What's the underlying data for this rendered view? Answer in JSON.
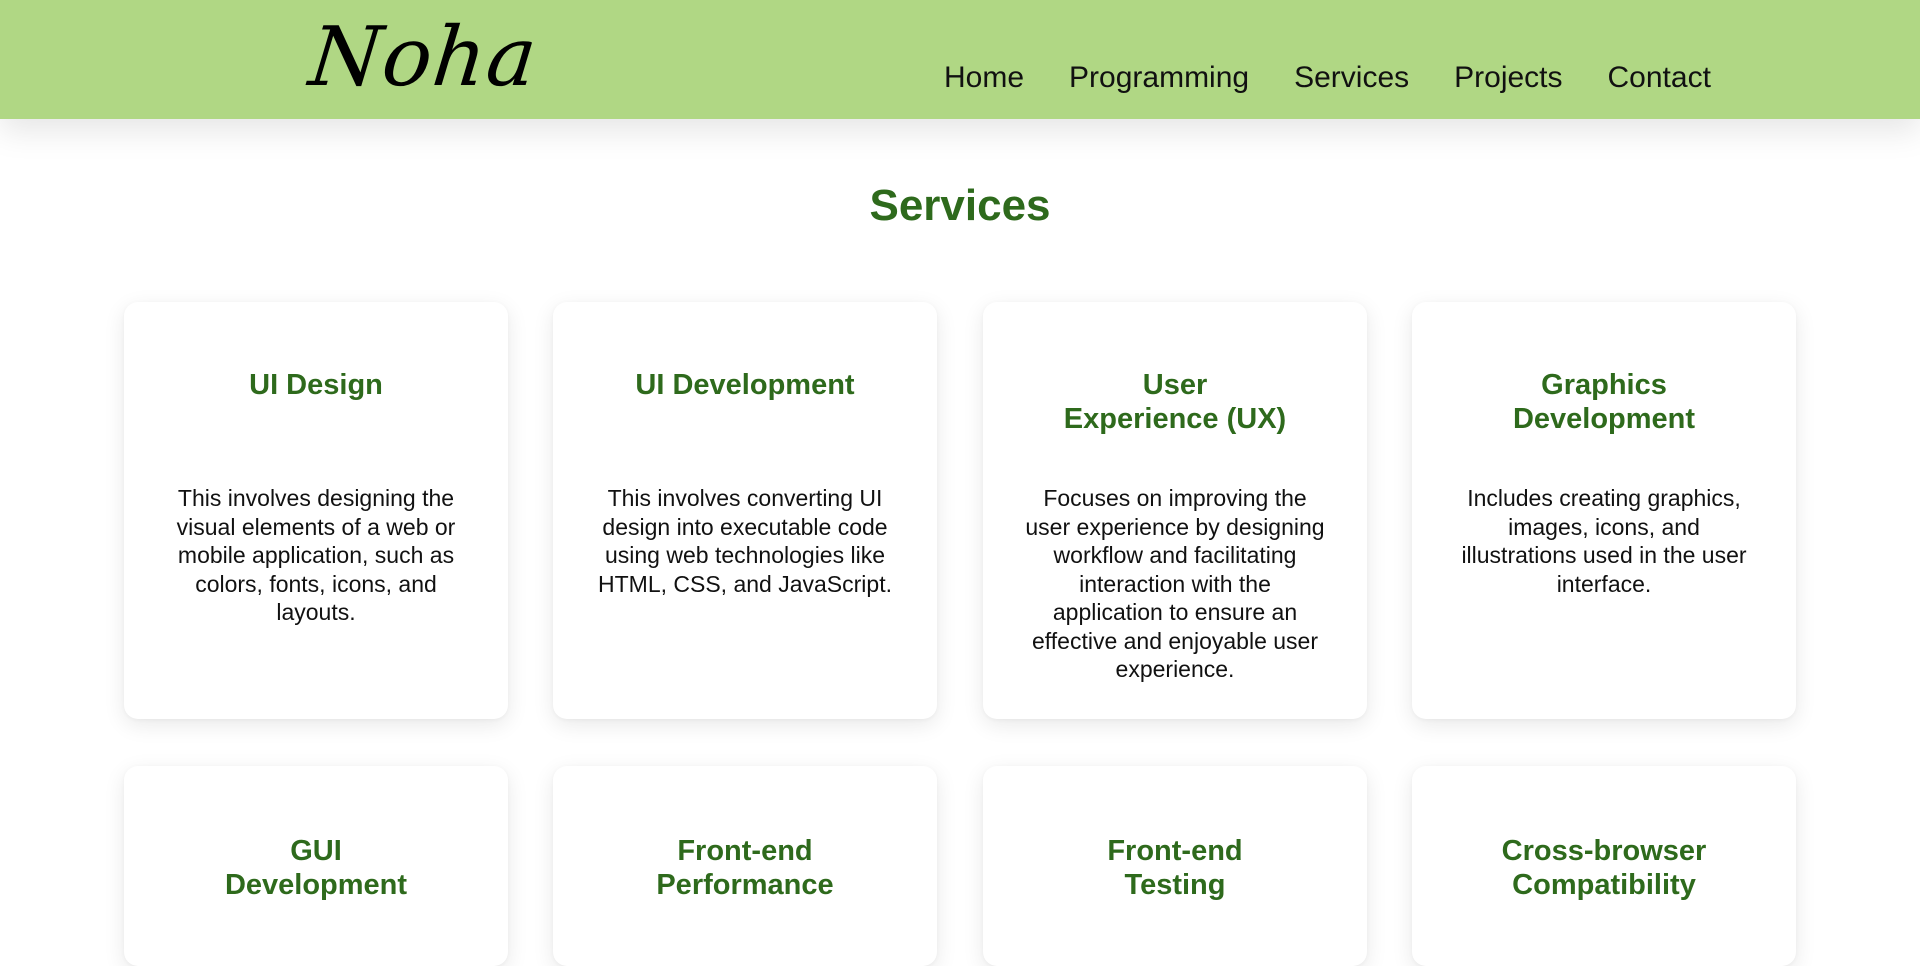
{
  "brand": {
    "logo_text": "Noha"
  },
  "nav": {
    "items": [
      {
        "label": "Home"
      },
      {
        "label": "Programming"
      },
      {
        "label": "Services"
      },
      {
        "label": "Projects"
      },
      {
        "label": "Contact"
      }
    ]
  },
  "colors": {
    "header_bg": "#b0d784",
    "accent": "#2e6a1c",
    "card_bg": "#ffffff"
  },
  "services": {
    "title": "Services",
    "cards": [
      {
        "title": "UI Design",
        "description": "This involves designing the visual elements of a web or mobile application, such as colors, fonts, icons, and layouts."
      },
      {
        "title": "UI Development",
        "description": "This involves converting UI design into executable code using web technologies like HTML, CSS, and JavaScript."
      },
      {
        "title": "User Experience (UX)",
        "description": "Focuses on improving the user experience by designing workflow and facilitating interaction with the application to ensure an effective and enjoyable user experience."
      },
      {
        "title": "Graphics Development",
        "description": "Includes creating graphics, images, icons, and illustrations used in the user interface."
      },
      {
        "title": "GUI Development",
        "description": ""
      },
      {
        "title": "Front-end Performance",
        "description": ""
      },
      {
        "title": "Front-end Testing",
        "description": ""
      },
      {
        "title": "Cross-browser Compatibility",
        "description": ""
      }
    ]
  }
}
